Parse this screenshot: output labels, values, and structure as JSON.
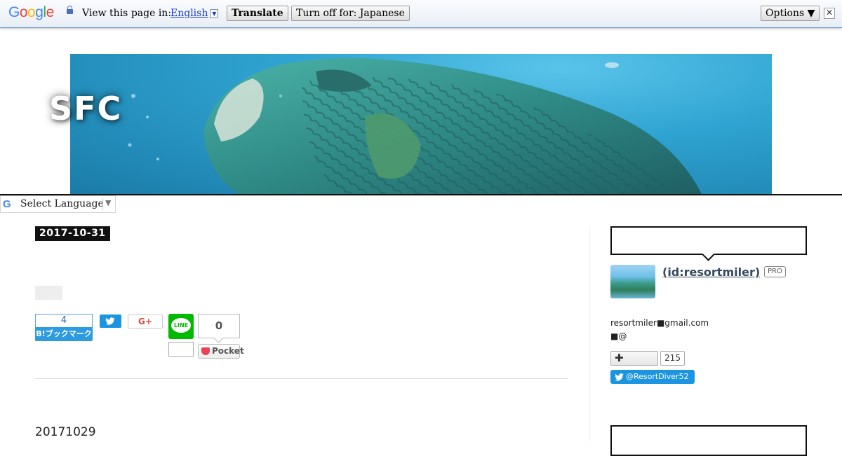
{
  "translate_bar": {
    "logo": "Google",
    "view_label": "View this page in:",
    "language": "English",
    "translate_button": "Translate",
    "turn_off_button": "Turn off for: Japanese",
    "options_button": "Options ▼",
    "close_glyph": "✕"
  },
  "header": {
    "site_title": "SFC"
  },
  "language_widget": {
    "logo": "G",
    "label": "Select Language",
    "arrow": "▼"
  },
  "article": {
    "date": "2017-10-31",
    "share": {
      "hatena_count": "4",
      "hatena_label": "B!ブックマーク",
      "gplus_label": "G+",
      "line_label": "LINE",
      "pocket_count": "0",
      "pocket_label": "Pocket"
    },
    "entry_title": "20171029"
  },
  "sidebar": {
    "profile": {
      "user_link": " (id:resortmiler)",
      "pro_badge": "PRO",
      "email": "resortmiler■gmail.com",
      "at_line": "■@",
      "follow_symbol": "✚",
      "follow_count": "215",
      "twitter_handle": "@ResortDiver52"
    }
  },
  "colors": {
    "twitter": "#1b95e0",
    "hatena": "#2c9be0",
    "line": "#00b900",
    "pocket": "#ef4056"
  }
}
